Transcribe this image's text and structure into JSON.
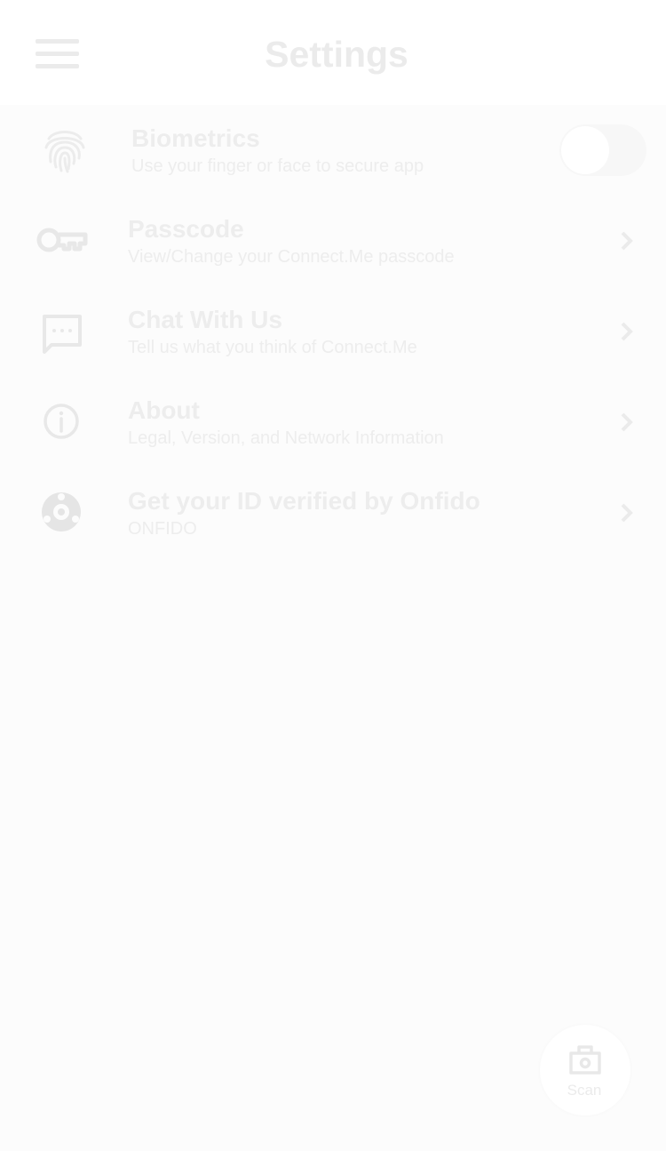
{
  "header": {
    "title": "Settings",
    "menu_icon": "hamburger-menu-icon"
  },
  "settings": {
    "biometrics": {
      "title": "Biometrics",
      "subtitle": "Use your finger or face to secure app",
      "icon": "fingerprint-icon",
      "toggle_on": false
    },
    "passcode": {
      "title": "Passcode",
      "subtitle": "View/Change your Connect.Me passcode",
      "icon": "key-icon"
    },
    "chat": {
      "title": "Chat With Us",
      "subtitle": "Tell us what you think of Connect.Me",
      "icon": "chat-bubble-icon"
    },
    "about": {
      "title": "About",
      "subtitle": "Legal, Version, and Network Information",
      "icon": "info-icon"
    },
    "onfido": {
      "title": "Get your ID verified by Onfido",
      "subtitle": "ONFIDO",
      "icon": "onfido-icon"
    }
  },
  "fab": {
    "label": "Scan",
    "icon": "camera-icon"
  },
  "colors": {
    "header_bg": "#ffffff",
    "content_bg": "#fcfcfc",
    "text": "#ededed"
  }
}
